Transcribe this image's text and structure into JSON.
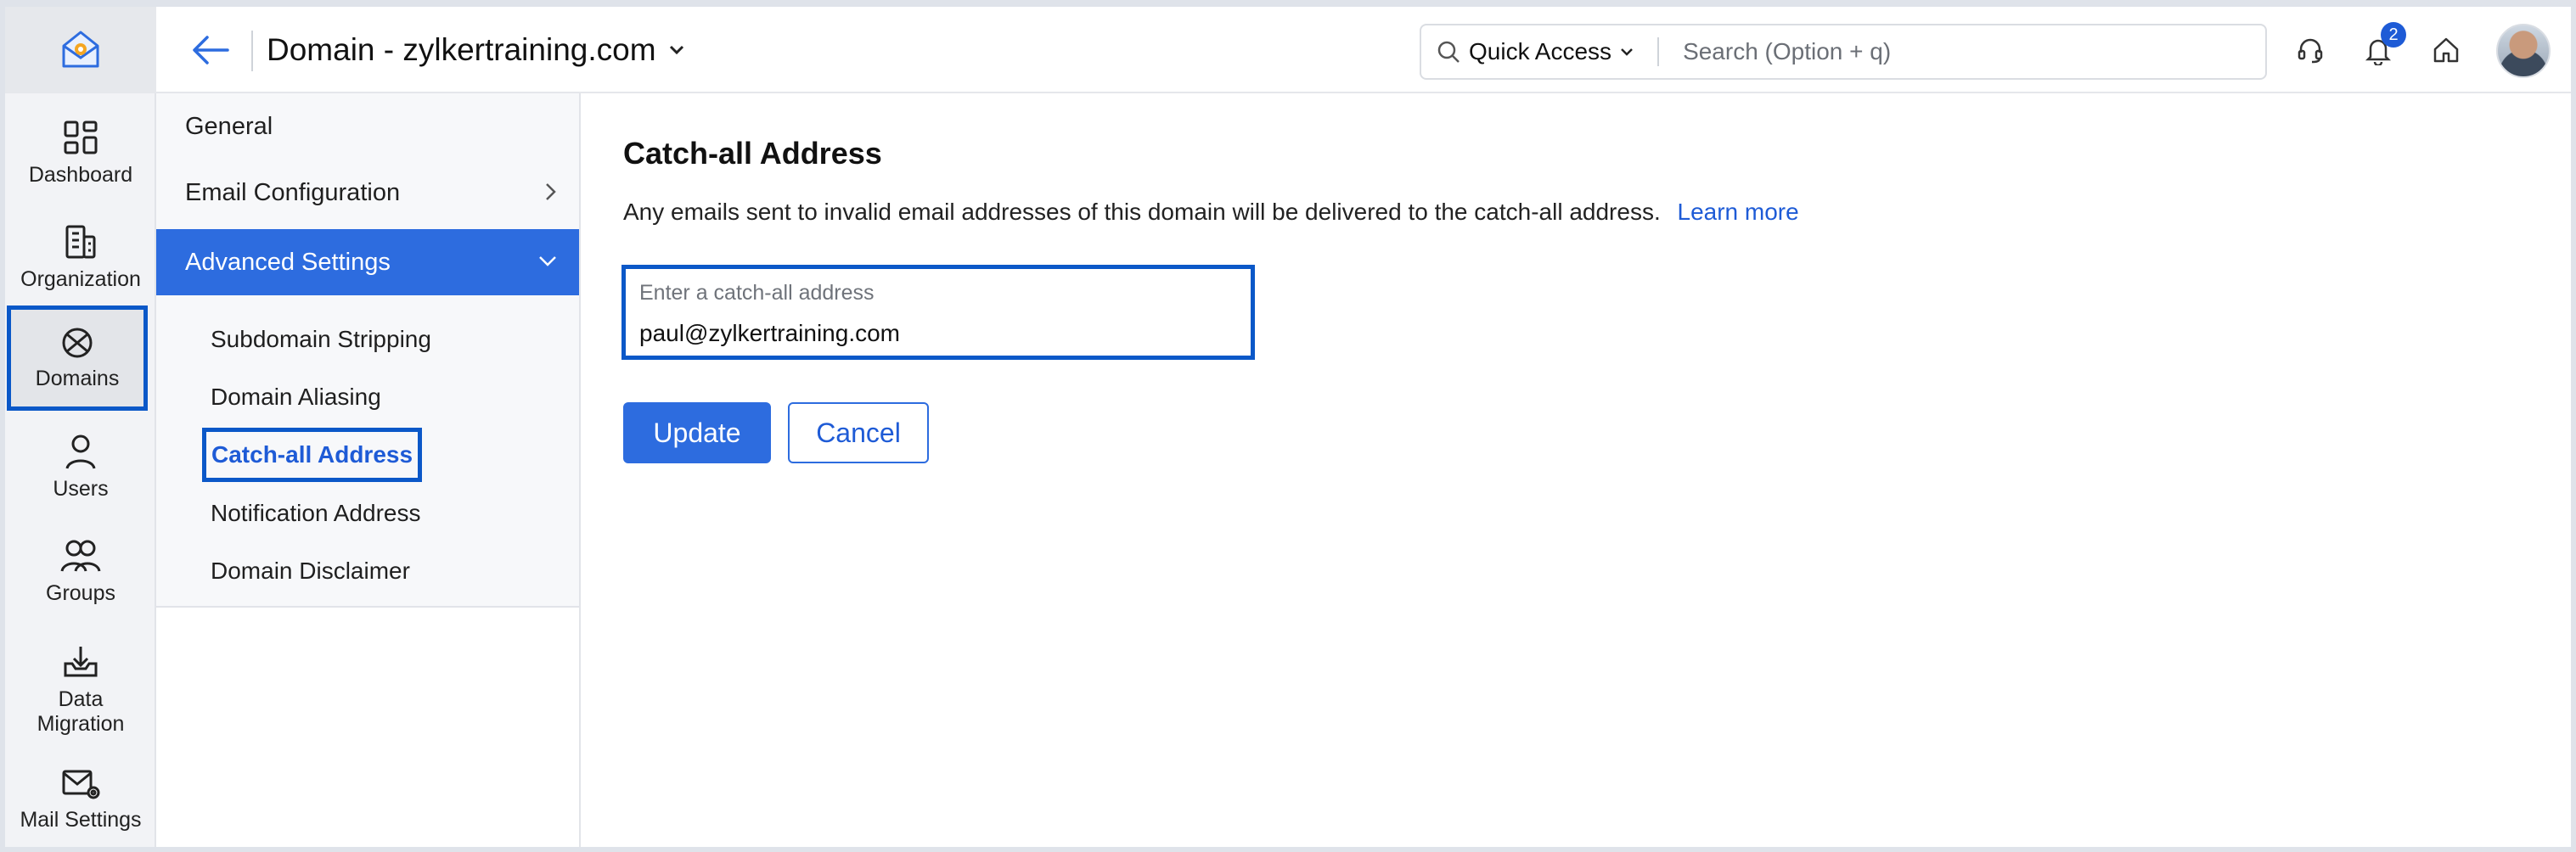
{
  "header": {
    "title": "Domain - zylkertraining.com",
    "quick_access_label": "Quick Access",
    "search_placeholder": "Search (Option + q)",
    "notification_count": "2"
  },
  "rail": {
    "items": [
      {
        "label": "Dashboard",
        "icon": "dashboard-icon"
      },
      {
        "label": "Organization",
        "icon": "organization-icon"
      },
      {
        "label": "Domains",
        "icon": "domains-icon"
      },
      {
        "label": "Users",
        "icon": "users-icon"
      },
      {
        "label": "Groups",
        "icon": "groups-icon"
      },
      {
        "label": "Data Migration",
        "icon": "data-migration-icon"
      },
      {
        "label": "Mail Settings",
        "icon": "mail-settings-icon"
      }
    ],
    "active": "Domains"
  },
  "subnav": {
    "general": "General",
    "email_configuration": "Email Configuration",
    "advanced_settings": "Advanced Settings",
    "sub_items": [
      "Subdomain Stripping",
      "Domain Aliasing",
      "Catch-all Address",
      "Notification Address",
      "Domain Disclaimer"
    ],
    "current": "Catch-all Address"
  },
  "main": {
    "title": "Catch-all Address",
    "description": "Any emails sent to invalid email addresses of this domain will be delivered to the catch-all address.",
    "learn_more": "Learn more",
    "field_label": "Enter a catch-all address",
    "field_value": "paul@zylkertraining.com",
    "update_label": "Update",
    "cancel_label": "Cancel"
  },
  "colors": {
    "accent": "#2d6cdf",
    "focus_outline": "#0b58c8",
    "link": "#1e5bd6"
  }
}
